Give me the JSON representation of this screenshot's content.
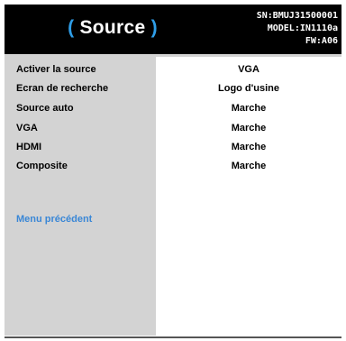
{
  "header": {
    "title": "Source",
    "sn": "SN:BMUJ31500001",
    "model": "MODEL:IN1110a",
    "fw": "FW:A06"
  },
  "menu": {
    "rows": [
      {
        "label": "Activer la source",
        "value": "VGA"
      },
      {
        "label": "Ecran de recherche",
        "value": "Logo d'usine"
      },
      {
        "label": "Source auto",
        "value": "Marche"
      },
      {
        "label": "VGA",
        "value": "Marche"
      },
      {
        "label": "HDMI",
        "value": "Marche"
      },
      {
        "label": "Composite",
        "value": "Marche"
      }
    ],
    "previous_label": "Menu précédent"
  },
  "colors": {
    "header_bg": "#000000",
    "accent": "#2f9ee8",
    "link": "#3a87d6",
    "body_bg": "#d3d3d3"
  }
}
